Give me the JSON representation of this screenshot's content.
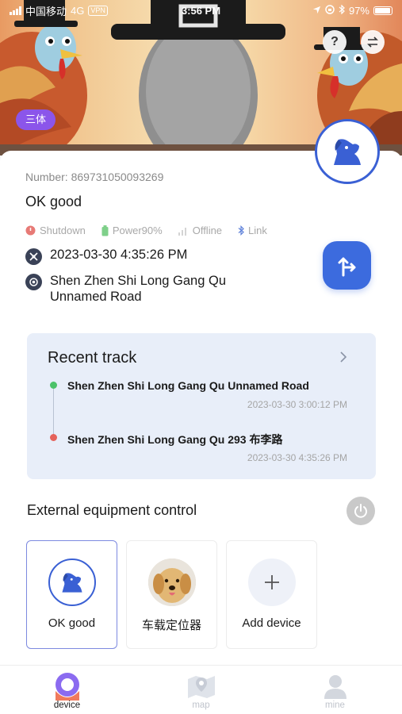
{
  "status_bar": {
    "carrier": "中国移动",
    "network": "4G",
    "vpn": "VPN",
    "time": "3:56 PM",
    "battery": "97%",
    "battery_level": 0.97
  },
  "hero": {
    "name_tag": "三体",
    "help_icon": "question-icon",
    "switch_icon": "swap-icon"
  },
  "device": {
    "number_label": "Number: 869731050093269",
    "name": "OK good",
    "status": {
      "shutdown": "Shutdown",
      "power": "Power90%",
      "offline": "Offline",
      "link": "Link"
    },
    "timestamp": "2023-03-30 4:35:26 PM",
    "address_line1": "Shen Zhen Shi Long Gang Qu",
    "address_line2": "Unnamed Road"
  },
  "recent_track": {
    "title": "Recent track",
    "items": [
      {
        "address": "Shen Zhen Shi Long Gang Qu Unnamed Road",
        "time": "2023-03-30 3:00:12 PM",
        "color": "#4cc26a"
      },
      {
        "address": "Shen Zhen Shi Long Gang Qu 293 布李路",
        "time": "2023-03-30 4:35:26 PM",
        "color": "#e5625b"
      }
    ]
  },
  "external": {
    "title": "External equipment control",
    "devices": [
      {
        "label": "OK good",
        "icon": "dog-icon",
        "selected": true
      },
      {
        "label": "车载定位器",
        "icon": "dog-photo",
        "selected": false
      },
      {
        "label": "Add device",
        "icon": "plus-icon",
        "selected": false
      }
    ]
  },
  "tabs": [
    {
      "label": "device",
      "active": true
    },
    {
      "label": "map",
      "active": false
    },
    {
      "label": "mine",
      "active": false
    }
  ],
  "colors": {
    "accent": "#3c6bde",
    "name_tag": "#8b55ea",
    "track_bg": "#e8eef9",
    "tab_active": "#f07a5c"
  }
}
